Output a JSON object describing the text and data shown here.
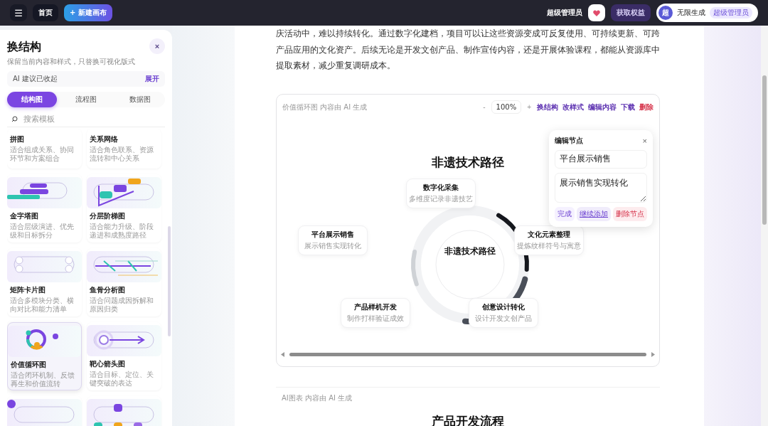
{
  "topbar": {
    "menu_icon": "☰",
    "home": "首页",
    "new_canvas": "+ 新建画布",
    "user_role": "超级管理员",
    "benefits": "获取权益",
    "avatar": "超",
    "plan": "无限生成",
    "plan_badge": "超级管理员"
  },
  "panel": {
    "title": "换结构",
    "close": "×",
    "subtitle": "保留当前内容和样式，只替换可视化版式",
    "ai_hint": "AI 建议已收起",
    "ai_toggle": "展开",
    "tabs": [
      {
        "label": "结构图",
        "selected": true
      },
      {
        "label": "流程图",
        "selected": false
      },
      {
        "label": "数据图",
        "selected": false
      }
    ],
    "search": {
      "placeholder": "搜索模板"
    },
    "templates": [
      {
        "name": "拼图",
        "desc": "适合组成关系、协同环节和方案组合",
        "selected": false
      },
      {
        "name": "关系网络",
        "desc": "适合角色联系、资源流转和中心关系",
        "selected": false
      },
      {
        "kind": "pyramid",
        "name": "金字塔图",
        "desc": "适合层级演进、优先级和目标拆分",
        "selected": false
      },
      {
        "kind": "stairs",
        "name": "分层阶梯图",
        "desc": "适合能力升级、阶段递进和成熟度路径",
        "selected": false
      },
      {
        "kind": "matrix",
        "name": "矩阵卡片图",
        "desc": "适合多模块分类、横向对比和能力清单",
        "selected": false
      },
      {
        "kind": "fishbone",
        "name": "鱼骨分析图",
        "desc": "适合问题成因拆解和原因归类",
        "selected": false
      },
      {
        "kind": "cycle",
        "name": "价值循环图",
        "desc": "适合闭环机制、反馈再生和价值流转",
        "selected": true
      },
      {
        "kind": "target",
        "name": "靶心箭头图",
        "desc": "适合目标、定位、关键突破的表达",
        "selected": false
      },
      {
        "kind": "dot",
        "selected": false
      },
      {
        "kind": "tree",
        "selected": false
      }
    ]
  },
  "document": {
    "paragraph": "庆活动中，难以持续转化。通过数字化建档，项目可以让这些资源变成可反复使用、可持续更新、可跨产品应用的文化资产。后续无论是开发文创产品、制作宣传内容，还是开展体验课程，都能从资源库中提取素材，减少重复调研成本。",
    "cycle_card": {
      "caption": "价值循环图 内容由 AI 生成",
      "zoom_out": "-",
      "zoom": "100%",
      "zoom_in": "+",
      "actions": [
        {
          "label": "换结构",
          "kind": "normal"
        },
        {
          "label": "改样式",
          "kind": "normal"
        },
        {
          "label": "编辑内容",
          "kind": "normal"
        },
        {
          "label": "下载",
          "kind": "normal"
        },
        {
          "label": "删除",
          "kind": "danger"
        }
      ],
      "title": "非遗技术路径",
      "center": "非遗技术路径",
      "nodes": [
        {
          "name": "数字化采集",
          "desc": "多维度记录非遗技艺"
        },
        {
          "name": "平台展示销售",
          "desc": "展示销售实现转化"
        },
        {
          "name": "文化元素整理",
          "desc": "提炼纹样符号与寓意"
        },
        {
          "name": "产品样机开发",
          "desc": "制作打样验证成效"
        },
        {
          "name": "创意设计转化",
          "desc": "设计开发文创产品"
        }
      ],
      "editor": {
        "title": "编辑节点",
        "close": "×",
        "name_value": "平台展示销售",
        "desc_value": "展示销售实现转化",
        "buttons": [
          {
            "label": "完成",
            "kind": "done"
          },
          {
            "label": "继续添加",
            "kind": "add"
          },
          {
            "label": "删除节点",
            "kind": "delete"
          }
        ]
      }
    },
    "flow_card": {
      "caption": "AI图表 内容由 AI 生成",
      "title": "产品开发流程"
    }
  }
}
